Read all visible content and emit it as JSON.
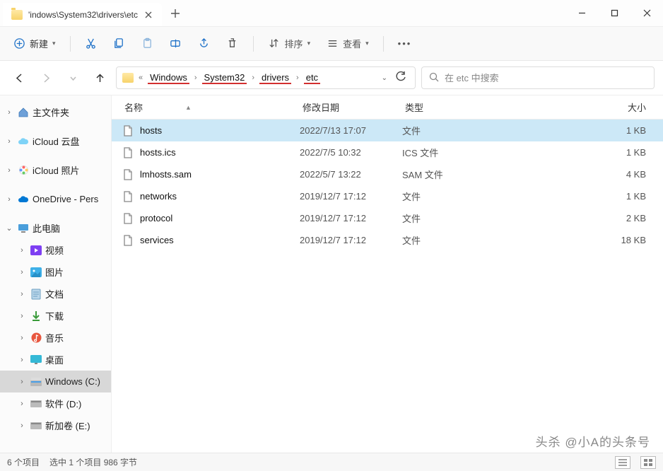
{
  "tab": {
    "title": "'indows\\System32\\drivers\\etc"
  },
  "toolbar": {
    "new_label": "新建",
    "sort_label": "排序",
    "view_label": "查看"
  },
  "breadcrumb": [
    "Windows",
    "System32",
    "drivers",
    "etc"
  ],
  "search": {
    "placeholder": "在 etc 中搜索"
  },
  "sidebar": {
    "home": "主文件夹",
    "icloud_drive": "iCloud 云盘",
    "icloud_photos": "iCloud 照片",
    "onedrive": "OneDrive - Pers",
    "thispc": "此电脑",
    "videos": "视频",
    "pictures": "图片",
    "documents": "文档",
    "downloads": "下载",
    "music": "音乐",
    "desktop": "桌面",
    "windows_c": "Windows (C:)",
    "software_d": "软件 (D:)",
    "newvol_e": "新加卷 (E:)"
  },
  "columns": {
    "name": "名称",
    "date": "修改日期",
    "type": "类型",
    "size": "大小"
  },
  "files": [
    {
      "name": "hosts",
      "date": "2022/7/13 17:07",
      "type": "文件",
      "size": "1 KB",
      "selected": true
    },
    {
      "name": "hosts.ics",
      "date": "2022/7/5 10:32",
      "type": "ICS 文件",
      "size": "1 KB",
      "selected": false
    },
    {
      "name": "lmhosts.sam",
      "date": "2022/5/7 13:22",
      "type": "SAM 文件",
      "size": "4 KB",
      "selected": false
    },
    {
      "name": "networks",
      "date": "2019/12/7 17:12",
      "type": "文件",
      "size": "1 KB",
      "selected": false
    },
    {
      "name": "protocol",
      "date": "2019/12/7 17:12",
      "type": "文件",
      "size": "2 KB",
      "selected": false
    },
    {
      "name": "services",
      "date": "2019/12/7 17:12",
      "type": "文件",
      "size": "18 KB",
      "selected": false
    }
  ],
  "status": {
    "count": "6 个项目",
    "selection": "选中 1 个项目  986 字节"
  },
  "watermark": "头杀 @小A的头条号"
}
